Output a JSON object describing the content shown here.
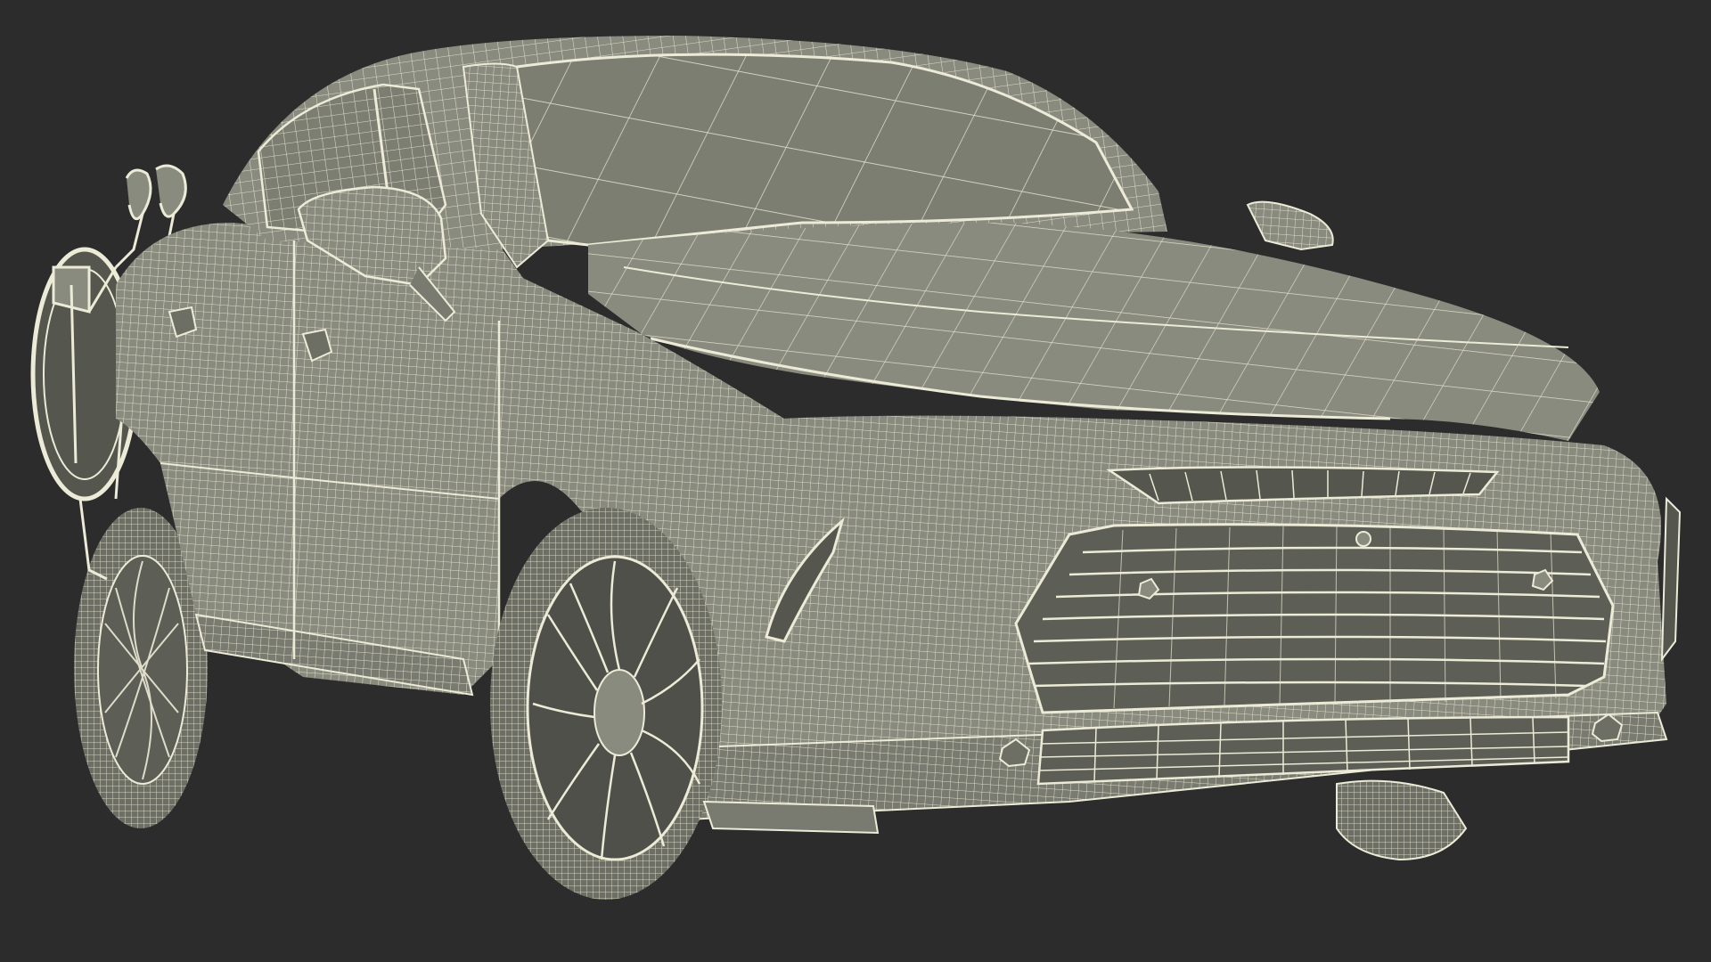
{
  "scene": {
    "background_color": "#2c2c2c",
    "model_fill_color": "#8a8b7f",
    "model_shadow_color": "#6e6f64",
    "wire_color": "#ecebd8",
    "glass_color": "#7d7e72",
    "render_mode": "wireframe-over-shaded",
    "icons": [
      "car-model",
      "bicycle-on-rack"
    ]
  }
}
